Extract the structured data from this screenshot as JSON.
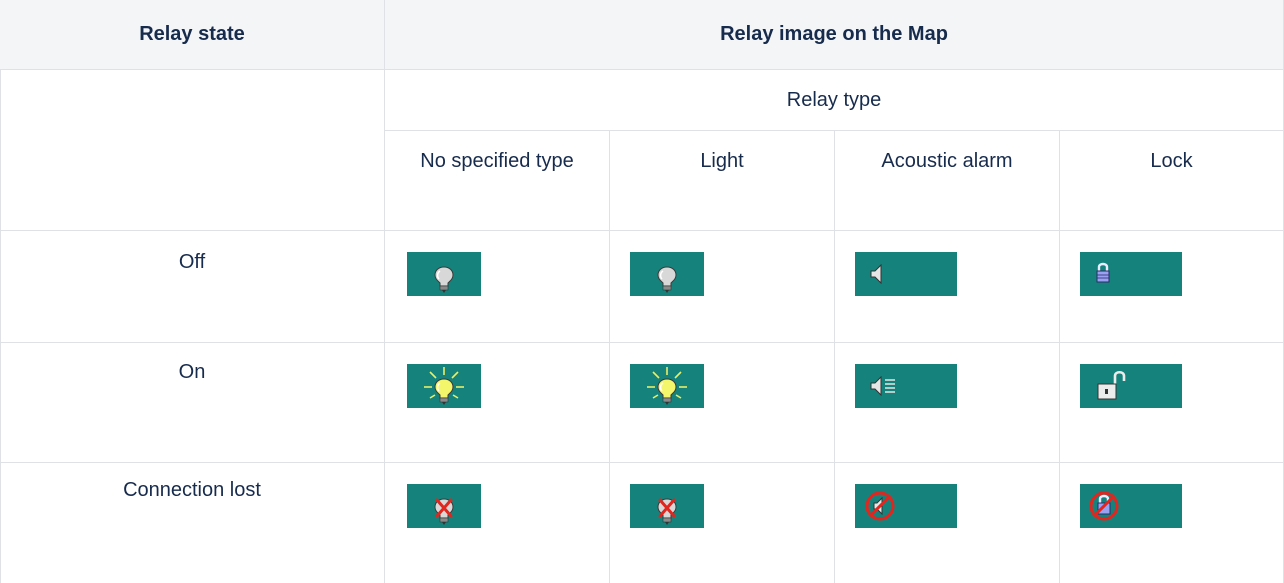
{
  "table": {
    "header": {
      "state_col": "Relay state",
      "image_col": "Relay image on the Map"
    },
    "relay_type_label": "Relay type",
    "types": [
      "No specified type",
      "Light",
      "Acoustic alarm",
      "Lock"
    ],
    "rows": [
      {
        "state": "Off",
        "icons": [
          "bulb-off-icon",
          "bulb-off-icon",
          "speaker-off-icon",
          "padlock-closed-icon"
        ]
      },
      {
        "state": "On",
        "icons": [
          "bulb-on-icon",
          "bulb-on-icon",
          "speaker-on-icon",
          "padlock-open-icon"
        ]
      },
      {
        "state": "Connection lost",
        "icons": [
          "bulb-lost-icon",
          "bulb-lost-icon",
          "speaker-lost-icon",
          "padlock-lost-icon"
        ]
      }
    ]
  },
  "colors": {
    "icon_background": "#15837c",
    "header_background": "#f4f5f7",
    "border": "#dfe1e6",
    "text": "#172b4d"
  }
}
